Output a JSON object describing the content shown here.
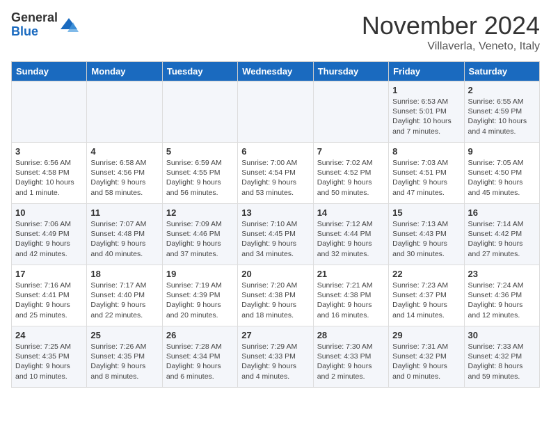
{
  "header": {
    "logo_general": "General",
    "logo_blue": "Blue",
    "month_title": "November 2024",
    "location": "Villaverla, Veneto, Italy"
  },
  "days_of_week": [
    "Sunday",
    "Monday",
    "Tuesday",
    "Wednesday",
    "Thursday",
    "Friday",
    "Saturday"
  ],
  "weeks": [
    [
      {
        "day": "",
        "info": ""
      },
      {
        "day": "",
        "info": ""
      },
      {
        "day": "",
        "info": ""
      },
      {
        "day": "",
        "info": ""
      },
      {
        "day": "",
        "info": ""
      },
      {
        "day": "1",
        "info": "Sunrise: 6:53 AM\nSunset: 5:01 PM\nDaylight: 10 hours and 7 minutes."
      },
      {
        "day": "2",
        "info": "Sunrise: 6:55 AM\nSunset: 4:59 PM\nDaylight: 10 hours and 4 minutes."
      }
    ],
    [
      {
        "day": "3",
        "info": "Sunrise: 6:56 AM\nSunset: 4:58 PM\nDaylight: 10 hours and 1 minute."
      },
      {
        "day": "4",
        "info": "Sunrise: 6:58 AM\nSunset: 4:56 PM\nDaylight: 9 hours and 58 minutes."
      },
      {
        "day": "5",
        "info": "Sunrise: 6:59 AM\nSunset: 4:55 PM\nDaylight: 9 hours and 56 minutes."
      },
      {
        "day": "6",
        "info": "Sunrise: 7:00 AM\nSunset: 4:54 PM\nDaylight: 9 hours and 53 minutes."
      },
      {
        "day": "7",
        "info": "Sunrise: 7:02 AM\nSunset: 4:52 PM\nDaylight: 9 hours and 50 minutes."
      },
      {
        "day": "8",
        "info": "Sunrise: 7:03 AM\nSunset: 4:51 PM\nDaylight: 9 hours and 47 minutes."
      },
      {
        "day": "9",
        "info": "Sunrise: 7:05 AM\nSunset: 4:50 PM\nDaylight: 9 hours and 45 minutes."
      }
    ],
    [
      {
        "day": "10",
        "info": "Sunrise: 7:06 AM\nSunset: 4:49 PM\nDaylight: 9 hours and 42 minutes."
      },
      {
        "day": "11",
        "info": "Sunrise: 7:07 AM\nSunset: 4:48 PM\nDaylight: 9 hours and 40 minutes."
      },
      {
        "day": "12",
        "info": "Sunrise: 7:09 AM\nSunset: 4:46 PM\nDaylight: 9 hours and 37 minutes."
      },
      {
        "day": "13",
        "info": "Sunrise: 7:10 AM\nSunset: 4:45 PM\nDaylight: 9 hours and 34 minutes."
      },
      {
        "day": "14",
        "info": "Sunrise: 7:12 AM\nSunset: 4:44 PM\nDaylight: 9 hours and 32 minutes."
      },
      {
        "day": "15",
        "info": "Sunrise: 7:13 AM\nSunset: 4:43 PM\nDaylight: 9 hours and 30 minutes."
      },
      {
        "day": "16",
        "info": "Sunrise: 7:14 AM\nSunset: 4:42 PM\nDaylight: 9 hours and 27 minutes."
      }
    ],
    [
      {
        "day": "17",
        "info": "Sunrise: 7:16 AM\nSunset: 4:41 PM\nDaylight: 9 hours and 25 minutes."
      },
      {
        "day": "18",
        "info": "Sunrise: 7:17 AM\nSunset: 4:40 PM\nDaylight: 9 hours and 22 minutes."
      },
      {
        "day": "19",
        "info": "Sunrise: 7:19 AM\nSunset: 4:39 PM\nDaylight: 9 hours and 20 minutes."
      },
      {
        "day": "20",
        "info": "Sunrise: 7:20 AM\nSunset: 4:38 PM\nDaylight: 9 hours and 18 minutes."
      },
      {
        "day": "21",
        "info": "Sunrise: 7:21 AM\nSunset: 4:38 PM\nDaylight: 9 hours and 16 minutes."
      },
      {
        "day": "22",
        "info": "Sunrise: 7:23 AM\nSunset: 4:37 PM\nDaylight: 9 hours and 14 minutes."
      },
      {
        "day": "23",
        "info": "Sunrise: 7:24 AM\nSunset: 4:36 PM\nDaylight: 9 hours and 12 minutes."
      }
    ],
    [
      {
        "day": "24",
        "info": "Sunrise: 7:25 AM\nSunset: 4:35 PM\nDaylight: 9 hours and 10 minutes."
      },
      {
        "day": "25",
        "info": "Sunrise: 7:26 AM\nSunset: 4:35 PM\nDaylight: 9 hours and 8 minutes."
      },
      {
        "day": "26",
        "info": "Sunrise: 7:28 AM\nSunset: 4:34 PM\nDaylight: 9 hours and 6 minutes."
      },
      {
        "day": "27",
        "info": "Sunrise: 7:29 AM\nSunset: 4:33 PM\nDaylight: 9 hours and 4 minutes."
      },
      {
        "day": "28",
        "info": "Sunrise: 7:30 AM\nSunset: 4:33 PM\nDaylight: 9 hours and 2 minutes."
      },
      {
        "day": "29",
        "info": "Sunrise: 7:31 AM\nSunset: 4:32 PM\nDaylight: 9 hours and 0 minutes."
      },
      {
        "day": "30",
        "info": "Sunrise: 7:33 AM\nSunset: 4:32 PM\nDaylight: 8 hours and 59 minutes."
      }
    ]
  ]
}
